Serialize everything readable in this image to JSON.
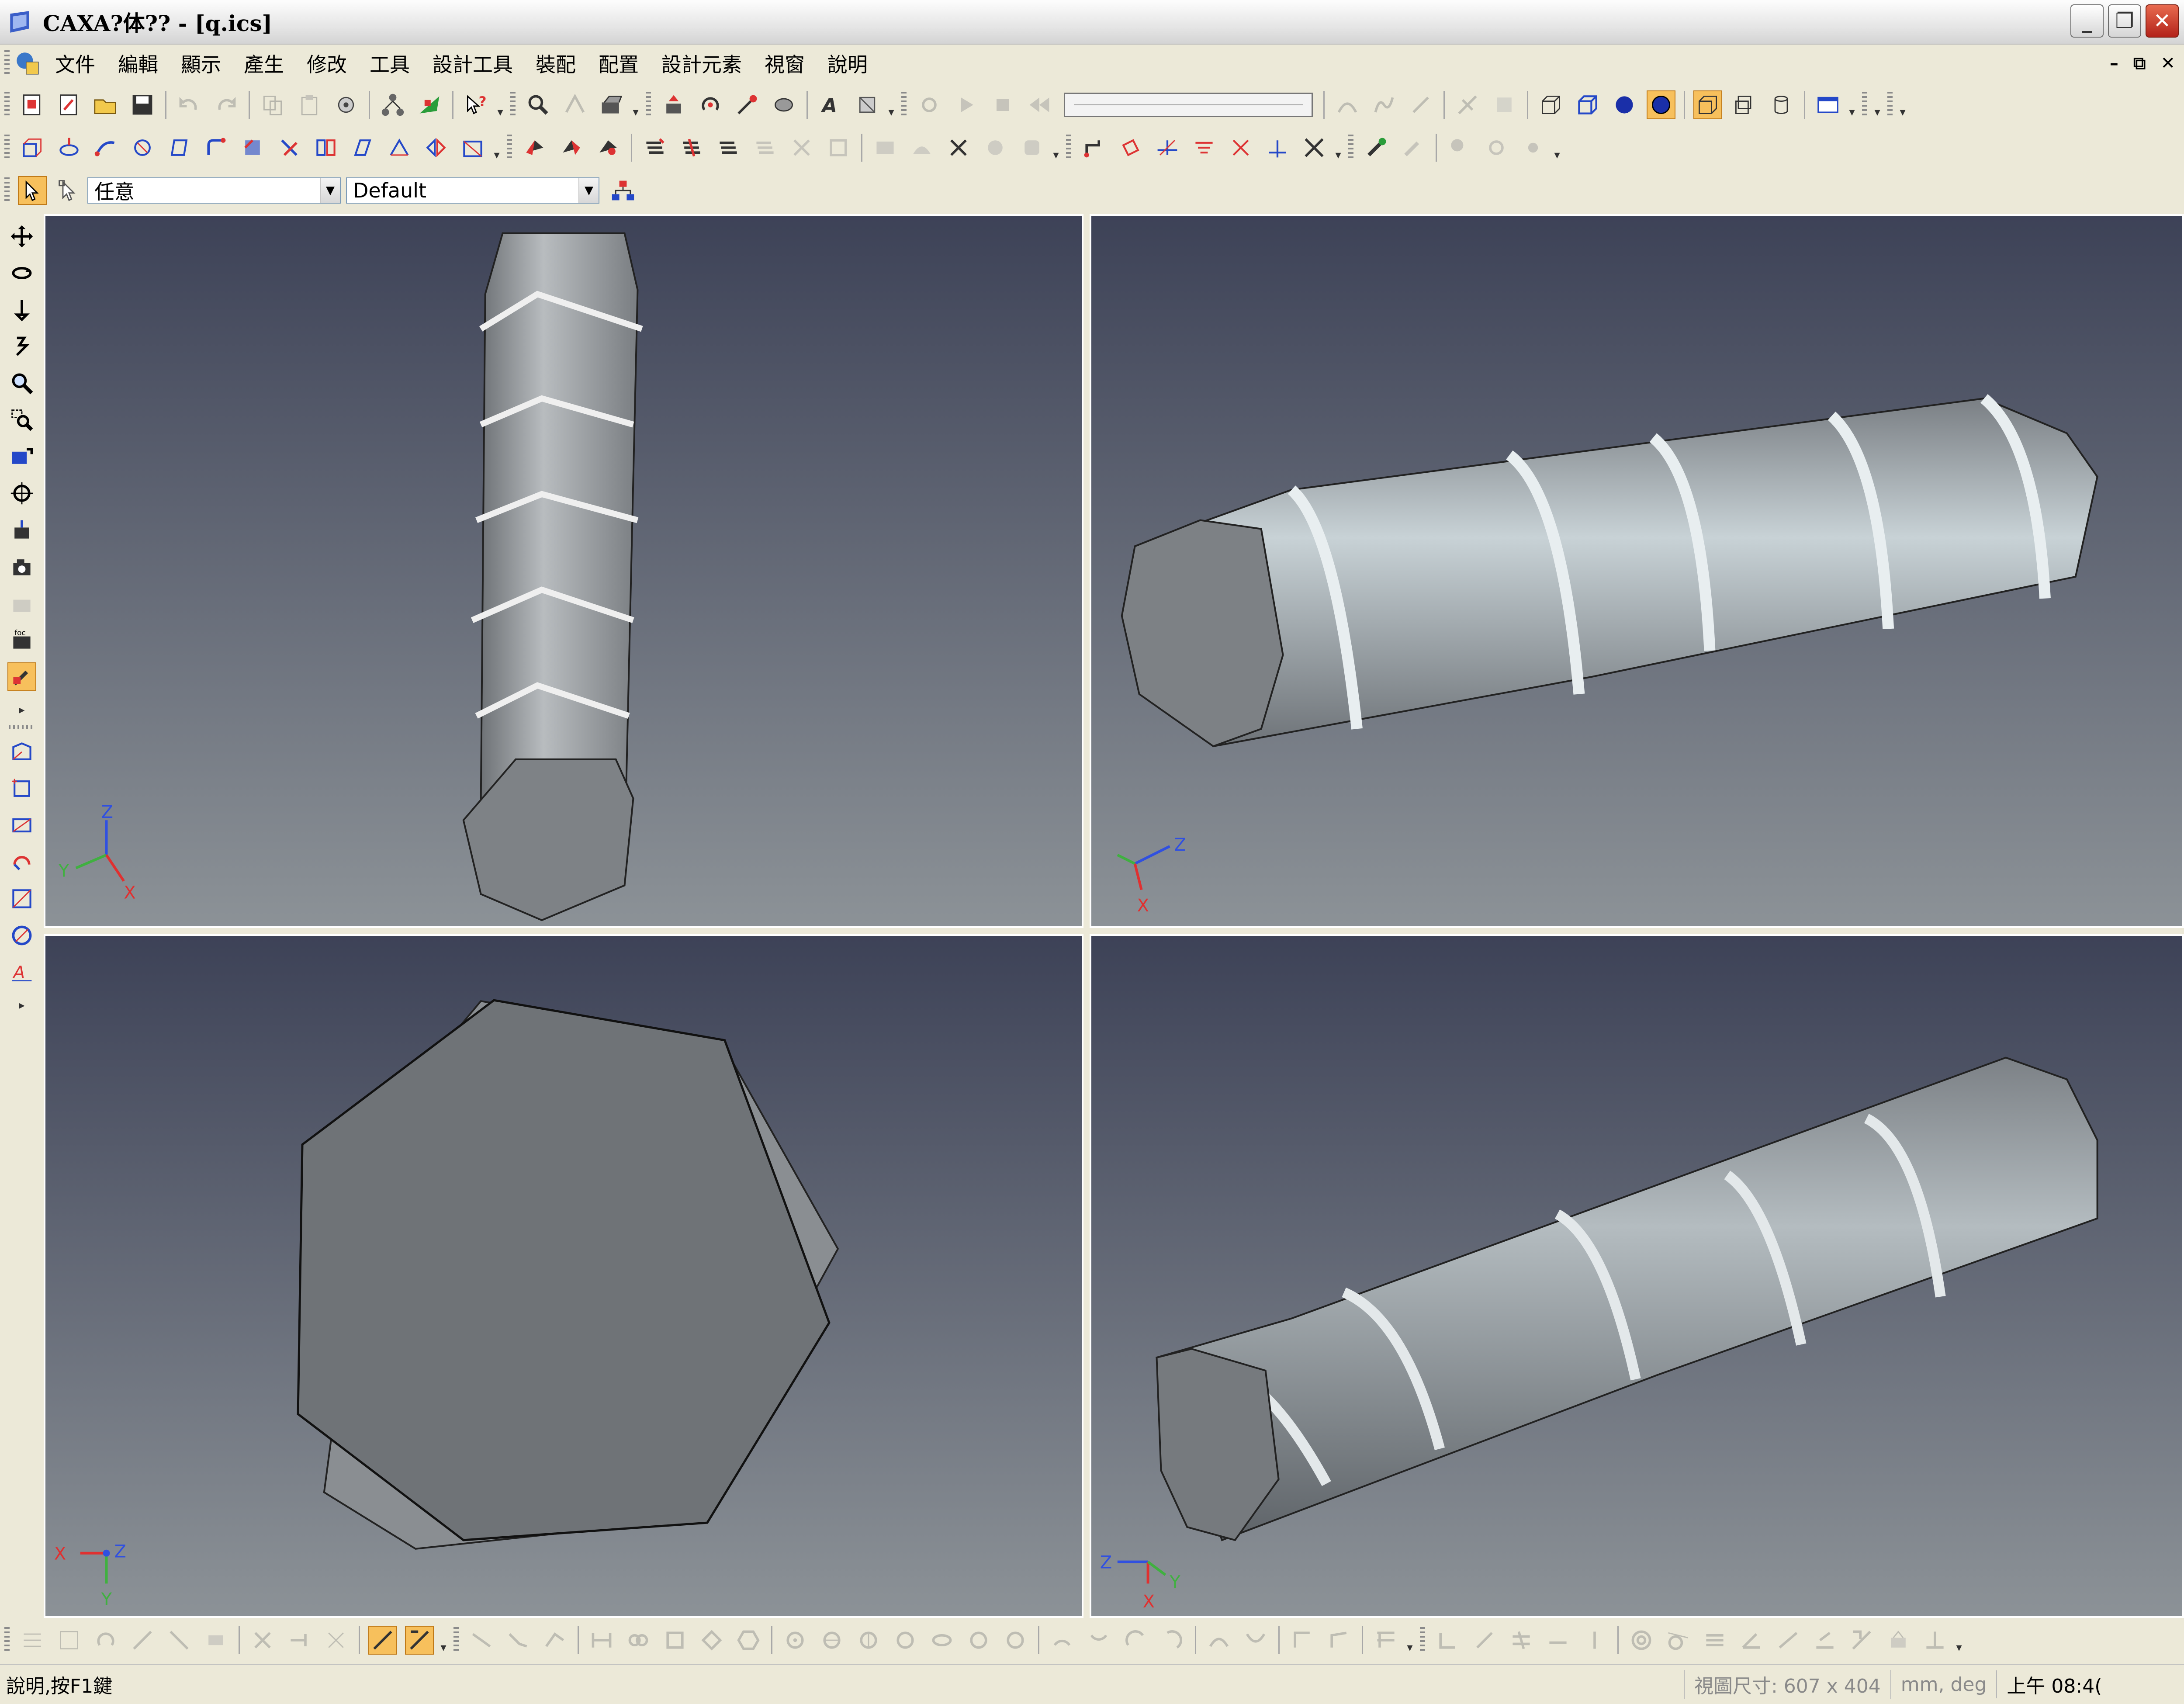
{
  "window": {
    "title": "CAXA?体?? - [q.ics]",
    "buttons": [
      "_",
      "❐",
      "✕"
    ]
  },
  "menu": {
    "items": [
      "文件",
      "編輯",
      "顯示",
      "產生",
      "修改",
      "工具",
      "設計工具",
      "裝配",
      "配置",
      "設計元素",
      "視窗",
      "說明"
    ],
    "mdi_buttons": [
      "–",
      "⧉",
      "✕"
    ]
  },
  "selection_bar": {
    "filter_value": "任意",
    "config_value": "Default"
  },
  "viewports": [
    {
      "name": "top-left",
      "axis_labels": [
        "Z",
        "Y",
        "X"
      ]
    },
    {
      "name": "top-right",
      "axis_labels": [
        "Z",
        "X"
      ]
    },
    {
      "name": "bottom-left",
      "axis_labels": [
        "X",
        "Z",
        "Y"
      ]
    },
    {
      "name": "bottom-right",
      "axis_labels": [
        "Z",
        "X",
        "Y"
      ]
    }
  ],
  "status": {
    "help_text": "說明,按F1鍵",
    "view_size": "視圖尺寸: 607 x 404",
    "units": "mm, deg",
    "clock": "上午 08:4("
  },
  "colors": {
    "viewport_top": "#3d4257",
    "viewport_bottom": "#8c9297",
    "model_fill": "#7d8185",
    "model_highlight": "#c8d2d6",
    "highlight_button": "#f7c05c",
    "axis_x": "#e03030",
    "axis_y": "#40b040",
    "axis_z": "#3050e0"
  }
}
